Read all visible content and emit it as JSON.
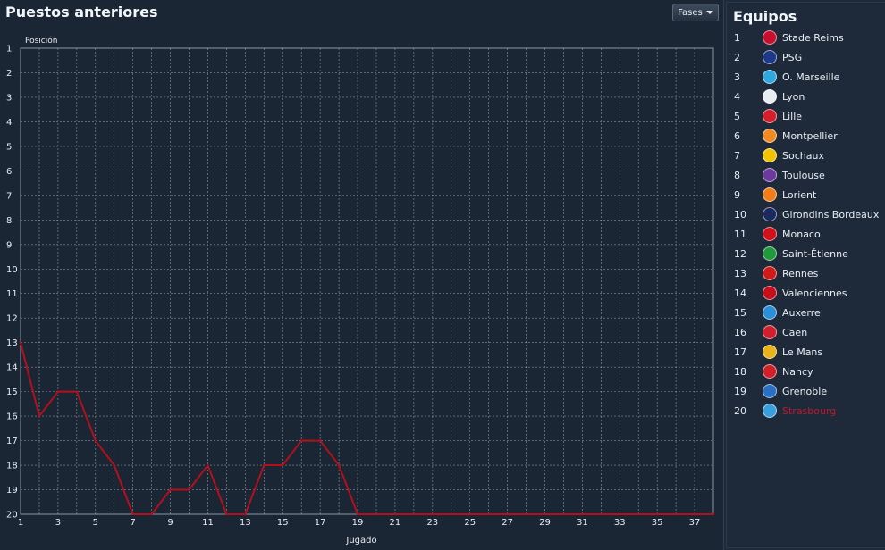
{
  "header": {
    "title": "Puestos anteriores",
    "phases_label": "Fases"
  },
  "colors": {
    "line": "#b3101c",
    "grid": "#b9c1ca",
    "plot_bg": "#1b2634",
    "highlight_team": "#c0192b"
  },
  "chart_data": {
    "type": "line",
    "title": "",
    "xlabel": "Jugado",
    "ylabel": "Posición",
    "xlim": [
      1,
      38
    ],
    "ylim": [
      1,
      20
    ],
    "y_inverted": true,
    "x_ticks": [
      1,
      3,
      5,
      7,
      9,
      11,
      13,
      15,
      17,
      19,
      21,
      23,
      25,
      27,
      29,
      31,
      33,
      35,
      37
    ],
    "y_ticks": [
      1,
      2,
      3,
      4,
      5,
      6,
      7,
      8,
      9,
      10,
      11,
      12,
      13,
      14,
      15,
      16,
      17,
      18,
      19,
      20
    ],
    "grid": true,
    "series": [
      {
        "x": [
          1,
          2,
          3,
          4,
          5,
          6,
          7,
          8,
          9,
          10,
          11,
          12,
          13,
          14,
          15,
          16,
          17,
          18,
          19,
          20,
          21,
          22,
          23,
          24,
          25,
          26,
          27,
          28,
          29,
          30,
          31,
          32,
          33,
          34,
          35,
          36,
          37,
          38
        ],
        "y": [
          13,
          16,
          15,
          15,
          17,
          18,
          20,
          20,
          19,
          19,
          18,
          20,
          20,
          18,
          18,
          17,
          17,
          18,
          20,
          20,
          20,
          20,
          20,
          20,
          20,
          20,
          20,
          20,
          20,
          20,
          20,
          20,
          20,
          20,
          20,
          20,
          20,
          20
        ]
      }
    ]
  },
  "sidebar": {
    "title": "Equipos",
    "teams": [
      {
        "pos": "1",
        "name": "Stade Reims",
        "badge": "#c8102e"
      },
      {
        "pos": "2",
        "name": "PSG",
        "badge": "#1d3a8a"
      },
      {
        "pos": "3",
        "name": "O. Marseille",
        "badge": "#2fa8e0"
      },
      {
        "pos": "4",
        "name": "Lyon",
        "badge": "#e8ecf2"
      },
      {
        "pos": "5",
        "name": "Lille",
        "badge": "#d4202c"
      },
      {
        "pos": "6",
        "name": "Montpellier",
        "badge": "#f08a24"
      },
      {
        "pos": "7",
        "name": "Sochaux",
        "badge": "#f2c400"
      },
      {
        "pos": "8",
        "name": "Toulouse",
        "badge": "#6b3a9c"
      },
      {
        "pos": "9",
        "name": "Lorient",
        "badge": "#f07d1a"
      },
      {
        "pos": "10",
        "name": "Girondins Bordeaux",
        "badge": "#1b2a5e"
      },
      {
        "pos": "11",
        "name": "Monaco",
        "badge": "#d0111c"
      },
      {
        "pos": "12",
        "name": "Saint-Étienne",
        "badge": "#1f9a3c"
      },
      {
        "pos": "13",
        "name": "Rennes",
        "badge": "#d11a1a"
      },
      {
        "pos": "14",
        "name": "Valenciennes",
        "badge": "#c4101c"
      },
      {
        "pos": "15",
        "name": "Auxerre",
        "badge": "#2a8fd6"
      },
      {
        "pos": "16",
        "name": "Caen",
        "badge": "#d21f2e"
      },
      {
        "pos": "17",
        "name": "Le Mans",
        "badge": "#e8b21a"
      },
      {
        "pos": "18",
        "name": "Nancy",
        "badge": "#d2202a"
      },
      {
        "pos": "19",
        "name": "Grenoble",
        "badge": "#2a6fc4"
      },
      {
        "pos": "20",
        "name": "Strasbourg",
        "badge": "#3aa0dd",
        "highlight": true
      }
    ]
  }
}
